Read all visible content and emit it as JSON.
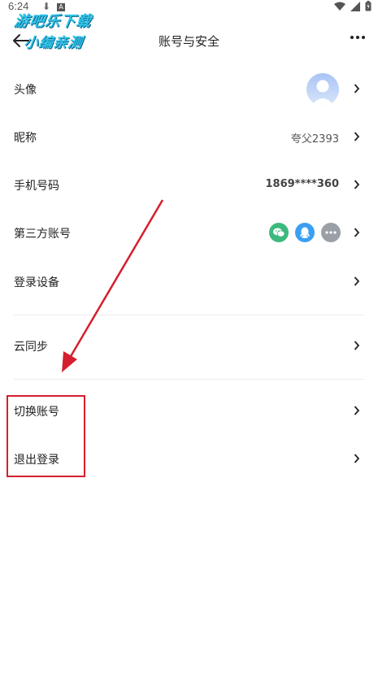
{
  "status_bar": {
    "time": "6:24",
    "download_glyph": "⬇",
    "a_glyph": "A"
  },
  "watermark": {
    "line1": "游吧乐下载",
    "line2": "小编亲测"
  },
  "header": {
    "title": "账号与安全"
  },
  "rows": {
    "avatar": {
      "label": "头像"
    },
    "nickname": {
      "label": "昵称",
      "value": "夸父2393"
    },
    "phone": {
      "label": "手机号码",
      "value": "1869****360"
    },
    "third_party": {
      "label": "第三方账号",
      "icons": [
        "wechat-icon",
        "qq-icon",
        "more-icon"
      ]
    },
    "devices": {
      "label": "登录设备"
    },
    "cloud_sync": {
      "label": "云同步"
    },
    "switch_account": {
      "label": "切换账号"
    },
    "logout": {
      "label": "退出登录"
    }
  },
  "colors": {
    "highlight": "#d4202e",
    "wechat": "#3cb97e",
    "qq": "#3a9ff2",
    "more": "#9aa0a6"
  }
}
